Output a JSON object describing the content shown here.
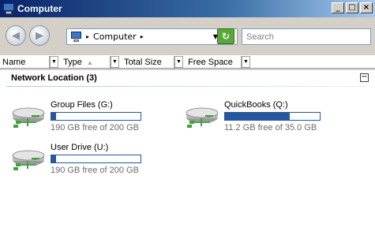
{
  "window": {
    "title": "Computer",
    "icon": "computer-icon",
    "buttons": {
      "minimize": "_",
      "maximize": "□",
      "close": "×"
    }
  },
  "toolbar": {
    "back_icon": "back-arrow-icon",
    "forward_icon": "forward-arrow-icon",
    "address": {
      "icon": "computer-icon",
      "separator": "▸",
      "text": "Computer",
      "location_dropdown": "▸"
    },
    "refresh_icon": "refresh-icon",
    "search": {
      "placeholder": "Search"
    }
  },
  "columns": [
    {
      "label": "Name"
    },
    {
      "label": "Type"
    },
    {
      "label": "Total Size"
    },
    {
      "label": "Free Space"
    }
  ],
  "group": {
    "label": "Network Location (3)",
    "collapse_glyph": "−"
  },
  "drives": [
    {
      "name": "Group Files (G:)",
      "free_text": "190 GB free of 200 GB",
      "used_fraction": 0.05,
      "icon": "network-drive-icon"
    },
    {
      "name": "QuickBooks (Q:)",
      "free_text": "11.2 GB free of 35.0 GB",
      "used_fraction": 0.68,
      "icon": "network-drive-icon"
    },
    {
      "name": "User Drive (U:)",
      "free_text": "190 GB free of 200 GB",
      "used_fraction": 0.05,
      "icon": "network-drive-icon"
    }
  ],
  "colors": {
    "titlebar_start": "#0a246a",
    "bar_fill": "#26579f",
    "free_text": "#6d6d6d"
  }
}
